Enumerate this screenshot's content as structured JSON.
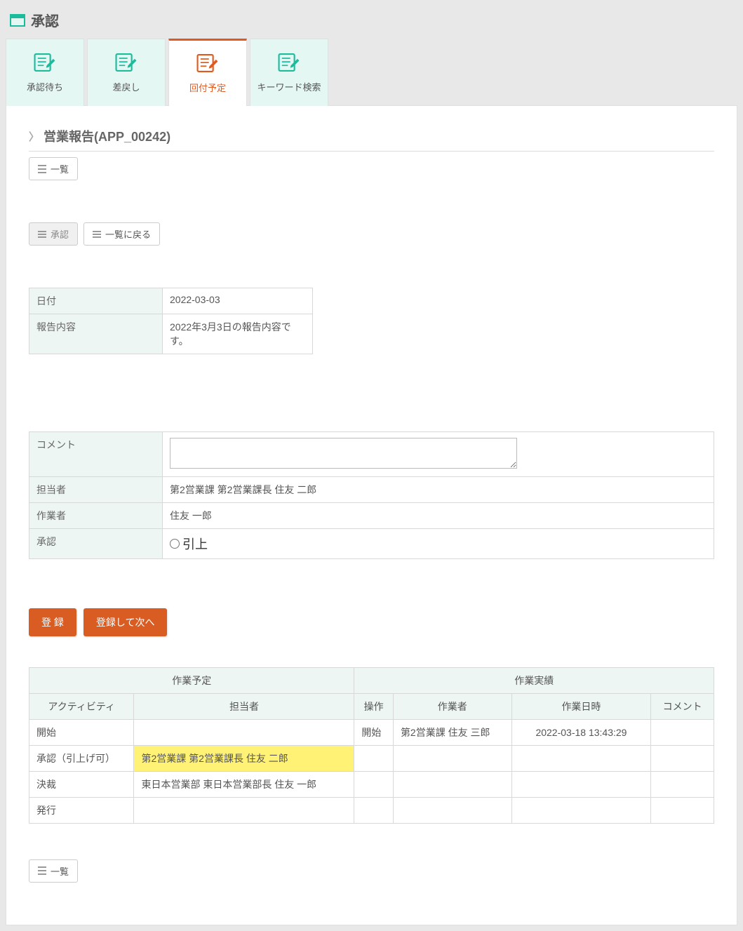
{
  "header": {
    "title": "承認"
  },
  "tabs": [
    {
      "label": "承認待ち"
    },
    {
      "label": "差戻し"
    },
    {
      "label": "回付予定"
    },
    {
      "label": "キーワード検索"
    }
  ],
  "section": {
    "title": "営業報告(APP_00242)"
  },
  "buttons": {
    "list": "一覧",
    "approve": "承認",
    "back_to_list": "一覧に戻る",
    "register": "登 録",
    "register_next": "登録して次へ",
    "list_bottom": "一覧"
  },
  "detail": {
    "date_label": "日付",
    "date_value": "2022-03-03",
    "content_label": "報告内容",
    "content_value": "2022年3月3日の報告内容です。"
  },
  "form": {
    "comment_label": "コメント",
    "comment_value": "",
    "assignee_label": "担当者",
    "assignee_value": "第2営業課 第2営業課長 住友 二郎",
    "worker_label": "作業者",
    "worker_value": "住友 一郎",
    "approval_label": "承認",
    "approval_option": "引上"
  },
  "schedule": {
    "group_plan": "作業予定",
    "group_actual": "作業実績",
    "col_activity": "アクティビティ",
    "col_assignee": "担当者",
    "col_op": "操作",
    "col_worker": "作業者",
    "col_datetime": "作業日時",
    "col_comment": "コメント",
    "rows": [
      {
        "activity": "開始",
        "assignee": "",
        "op": "開始",
        "worker": "第2営業課 住友 三郎",
        "datetime": "2022-03-18 13:43:29",
        "comment": ""
      },
      {
        "activity": "承認（引上げ可）",
        "assignee": "第2営業課 第2営業課長 住友 二郎",
        "op": "",
        "worker": "",
        "datetime": "",
        "comment": "",
        "highlight": true
      },
      {
        "activity": "決裁",
        "assignee": "東日本営業部 東日本営業部長 住友 一郎",
        "op": "",
        "worker": "",
        "datetime": "",
        "comment": ""
      },
      {
        "activity": "発行",
        "assignee": "",
        "op": "",
        "worker": "",
        "datetime": "",
        "comment": ""
      }
    ]
  }
}
